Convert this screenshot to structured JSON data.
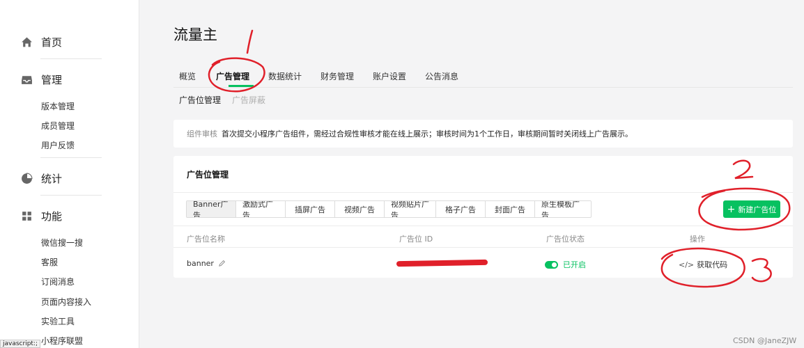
{
  "sidebar": {
    "home": {
      "label": "首页",
      "icon": "home-icon"
    },
    "manage": {
      "label": "管理",
      "icon": "inbox-icon",
      "items": [
        "版本管理",
        "成员管理",
        "用户反馈"
      ]
    },
    "stats": {
      "label": "统计",
      "icon": "pie-chart-icon"
    },
    "features": {
      "label": "功能",
      "icon": "grid-icon",
      "items": [
        "微信搜一搜",
        "客服",
        "订阅消息",
        "页面内容接入",
        "实验工具",
        "小程序联盟"
      ]
    }
  },
  "page": {
    "title": "流量主"
  },
  "tabs": [
    "概览",
    "广告管理",
    "数据统计",
    "财务管理",
    "账户设置",
    "公告消息"
  ],
  "active_tab": "广告管理",
  "subtabs": [
    "广告位管理",
    "广告屏蔽"
  ],
  "notice": {
    "label": "组件审核",
    "text": "首次提交小程序广告组件，需经过合规性审核才能在线上展示；审核时间为1个工作日，审核期间暂时关闭线上广告展示。"
  },
  "panel": {
    "title": "广告位管理",
    "ad_types": [
      "Banner广告",
      "激励式广告",
      "插屏广告",
      "视频广告",
      "视频贴片广告",
      "格子广告",
      "封面广告",
      "原生模板广告"
    ],
    "selected_type": "Banner广告",
    "new_button": "新建广告位",
    "columns": [
      "广告位名称",
      "广告位 ID",
      "广告位状态",
      "操作"
    ],
    "rows": [
      {
        "name": "banner",
        "id": "",
        "status": "已开启",
        "action": "获取代码",
        "action_icon": "</>"
      }
    ]
  },
  "annotations": {
    "numbers": [
      "1",
      "2",
      "3"
    ],
    "color": "#e0202a"
  },
  "accent_color": "#07c160",
  "status_bar": "javascript:;",
  "watermark": "CSDN @JaneZJW"
}
